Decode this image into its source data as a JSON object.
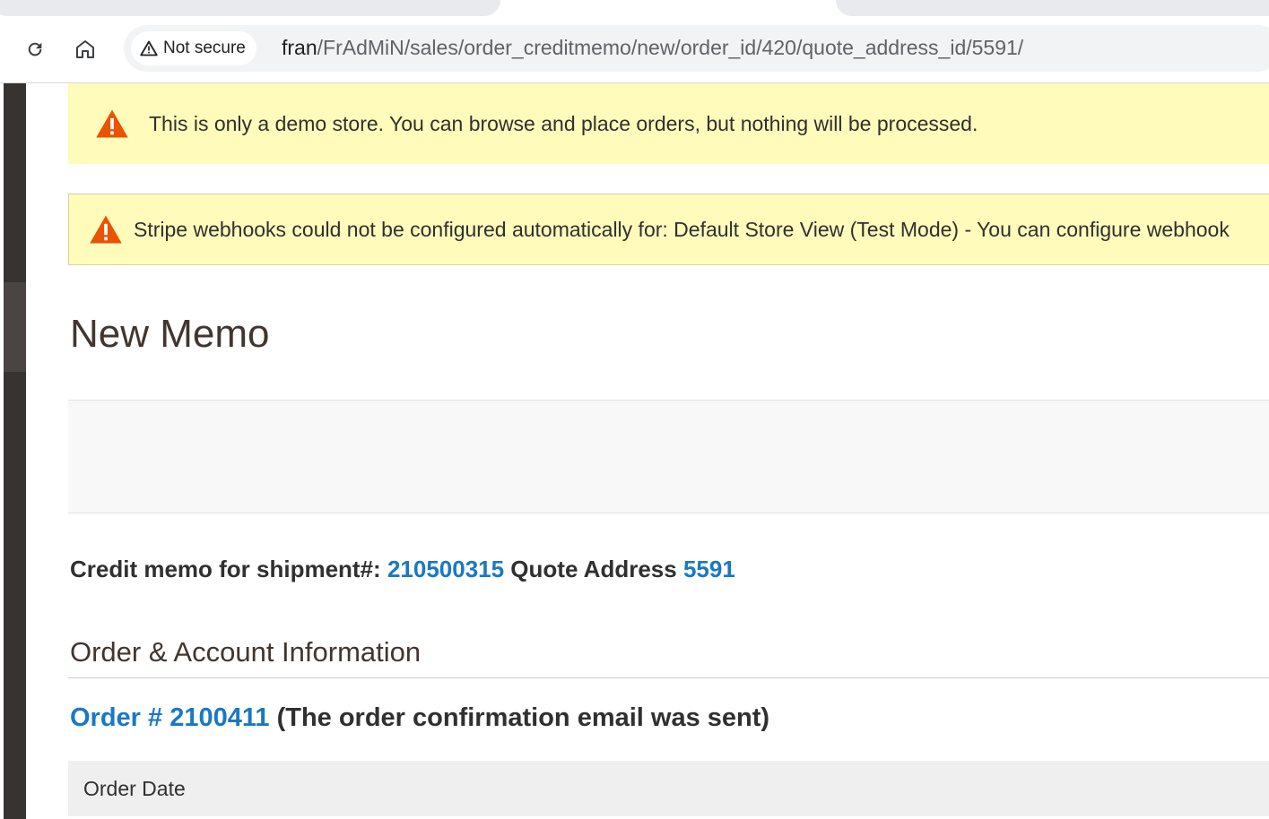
{
  "browser": {
    "security_chip": "Not secure",
    "url_host": "fran",
    "url_path": "/FrAdMiN/sales/order_creditmemo/new/order_id/420/quote_address_id/5591/"
  },
  "messages": {
    "demo_notice": "This is only a demo store. You can browse and place orders, but nothing will be processed.",
    "stripe_notice": "Stripe webhooks could not be configured automatically for: Default Store View (Test Mode) - You can configure webhook"
  },
  "page": {
    "title": "New Memo"
  },
  "memo": {
    "prefix": "Credit memo for shipment#: ",
    "shipment_number": "210500315",
    "middle": " Quote Address ",
    "quote_address": "5591"
  },
  "section": {
    "title": "Order & Account Information"
  },
  "order": {
    "link_text": "Order # 2100411",
    "status_text": " (The order confirmation email was sent)"
  },
  "table": {
    "header_label": "Order Date"
  },
  "colors": {
    "warning_bg": "#fffbbb",
    "warning_icon": "#eb5202",
    "link": "#1979c3"
  }
}
